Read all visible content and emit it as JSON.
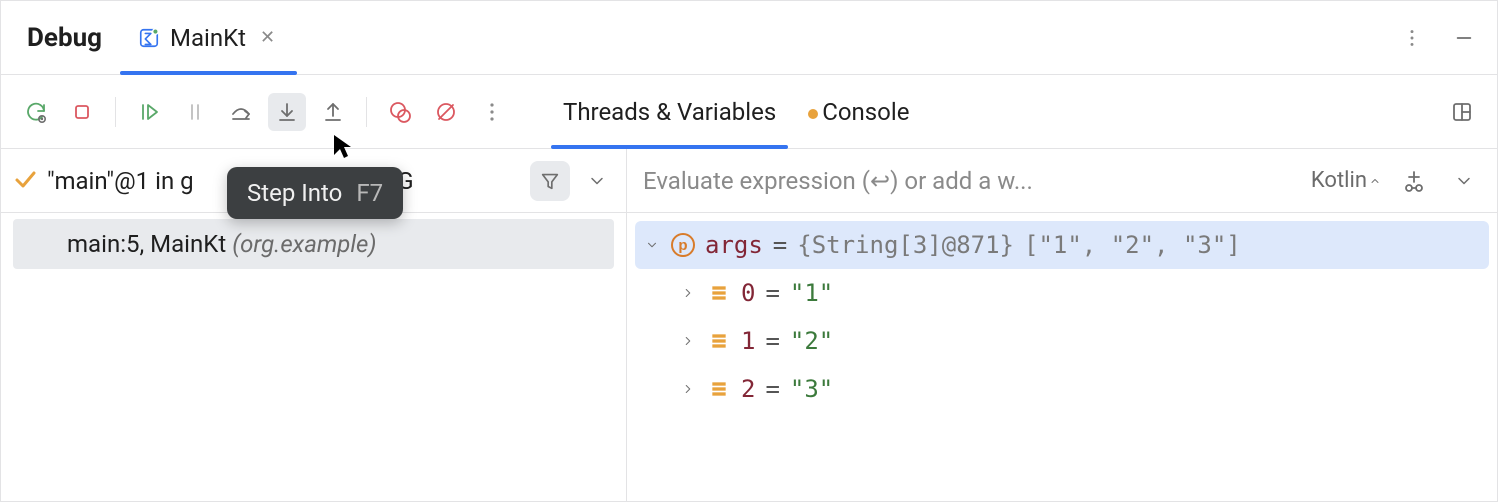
{
  "title": "Debug",
  "runTab": {
    "label": "MainKt"
  },
  "tooltip": {
    "label": "Step Into",
    "shortcut": "F7"
  },
  "viewTabs": {
    "threads": "Threads & Variables",
    "console": "Console"
  },
  "frames": {
    "thread_main": "\"main\"@1 in g",
    "thread_suffix": "ING",
    "current": {
      "loc": "main:5, MainKt",
      "pkg": "(org.example)"
    }
  },
  "eval": {
    "placeholder": "Evaluate expression (↩) or add a w...",
    "language": "Kotlin"
  },
  "vars": {
    "root": {
      "name": "args",
      "type": "{String[3]@871}",
      "preview": "[\"1\", \"2\", \"3\"]"
    },
    "items": [
      {
        "idx": "0",
        "val": "\"1\""
      },
      {
        "idx": "1",
        "val": "\"2\""
      },
      {
        "idx": "2",
        "val": "\"3\""
      }
    ]
  }
}
